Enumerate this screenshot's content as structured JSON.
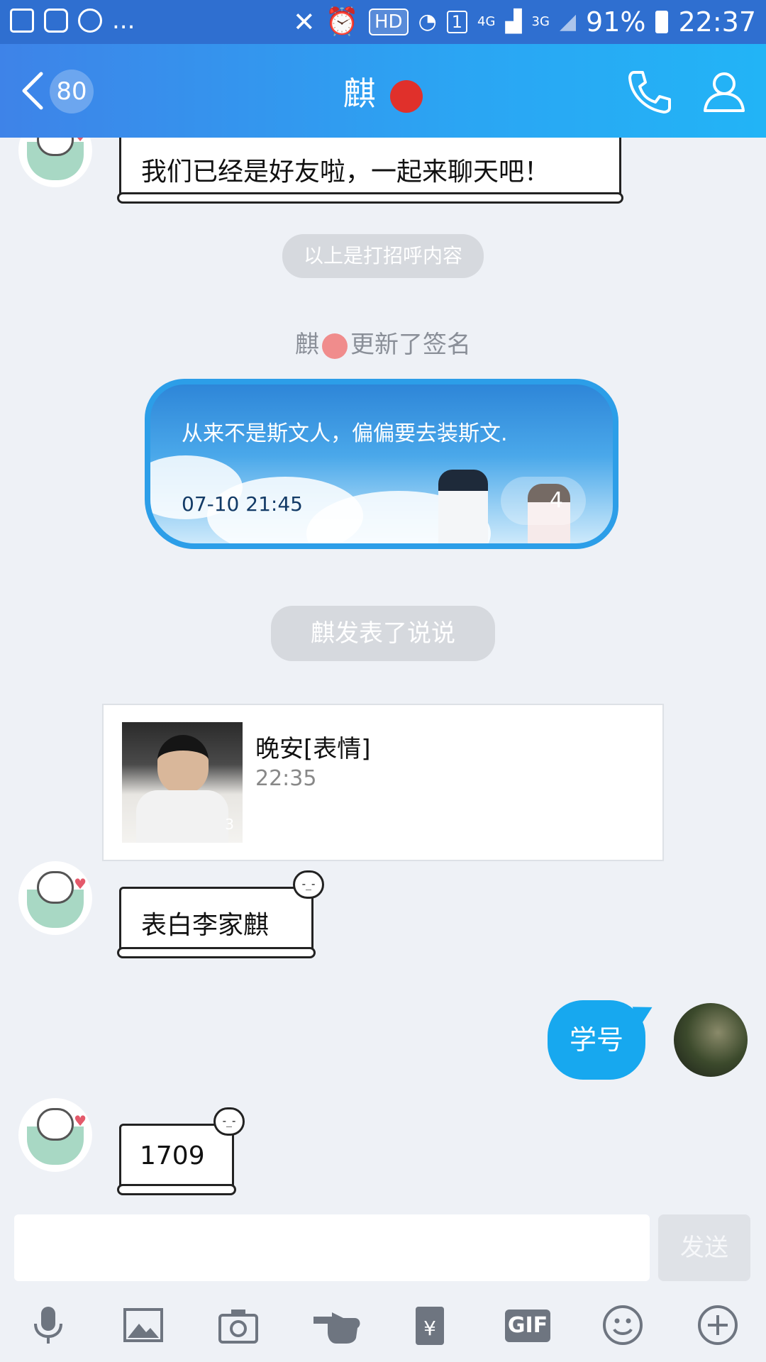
{
  "status_bar": {
    "left_dots": "...",
    "hd": "HD",
    "sim": "1",
    "net1": "4G",
    "net2": "3G",
    "battery": "91%",
    "time": "22:37"
  },
  "header": {
    "badge": "80",
    "title": "麒"
  },
  "messages": {
    "greeting_text": "我们已经是好友啦，一起来聊天吧！",
    "greeting_pill": "以上是打招呼内容",
    "sig_update_name": "麒",
    "sig_update_rest": "更新了签名",
    "signature_text": "从来不是斯文人，偏偏要去装斯文.",
    "signature_time": "07-10 21:45",
    "signature_count": "4",
    "post_notice_name": "麒",
    "post_notice_rest": "发表了说说",
    "post_title": "晚安[表情]",
    "post_time": "22:35",
    "post_thumb_count": "3",
    "msg_confess": "表白李家麒",
    "my_msg": "学号",
    "msg_number": "1709"
  },
  "input": {
    "placeholder": "",
    "send_label": "发送"
  },
  "toolbar": {
    "gif_label": "GIF"
  },
  "colors": {
    "header_start": "#3e83e8",
    "header_end": "#22b4f6",
    "bubble": "#17a8ef",
    "background": "#eef1f6"
  }
}
